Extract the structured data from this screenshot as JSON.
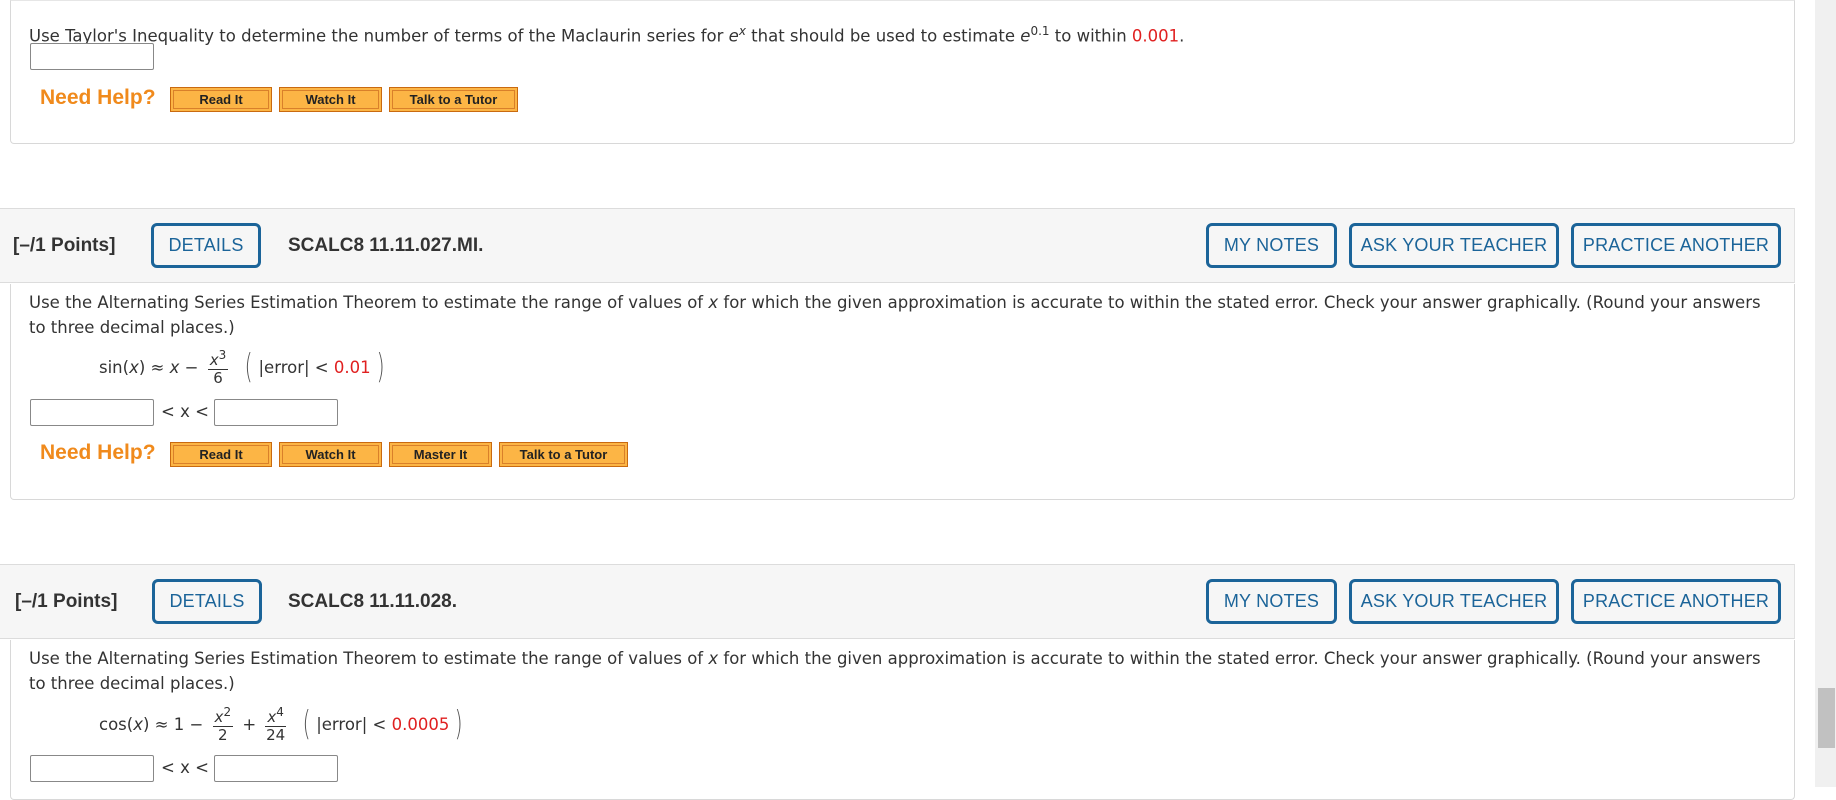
{
  "problems": [
    {
      "text_before_ex": "Use Taylor's Inequality to determine the number of terms of the Maclaurin series for ",
      "ex_base": "e",
      "ex_exp": "x",
      "text_mid": " that should be used to estimate ",
      "e_base": "e",
      "e_exp": "0.1",
      "text_after": " to within ",
      "tolerance": "0.001",
      "period": ".",
      "answer_value": "",
      "need_help": "Need Help?",
      "help_buttons": [
        "Read It",
        "Watch It",
        "Talk to a Tutor"
      ]
    },
    {
      "points": "[–/1 Points]",
      "details": "DETAILS",
      "id": "SCALC8 11.11.027.MI.",
      "actions": [
        "MY NOTES",
        "ASK YOUR TEACHER",
        "PRACTICE ANOTHER"
      ],
      "text_a": "Use the Alternating Series Estimation Theorem to estimate the range of values of ",
      "var": "x",
      "text_b": " for which the given approximation is accurate to within the stated error. Check your answer graphically. (Round your answers to three decimal places.)",
      "formula": {
        "lhs": "sin(",
        "lhs_var": "x",
        "lhs_close": ")",
        "approx": " ≈ ",
        "term1": "x",
        "minus": " − ",
        "frac_num_var": "x",
        "frac_num_exp": "3",
        "frac_den": "6",
        "error_label": "|error| < ",
        "error_value": "0.01"
      },
      "between": "< x <",
      "lower_value": "",
      "upper_value": "",
      "need_help": "Need Help?",
      "help_buttons": [
        "Read It",
        "Watch It",
        "Master It",
        "Talk to a Tutor"
      ]
    },
    {
      "points": "[–/1 Points]",
      "details": "DETAILS",
      "id": "SCALC8 11.11.028.",
      "actions": [
        "MY NOTES",
        "ASK YOUR TEACHER",
        "PRACTICE ANOTHER"
      ],
      "text_a": "Use the Alternating Series Estimation Theorem to estimate the range of values of ",
      "var": "x",
      "text_b": " for which the given approximation is accurate to within the stated error. Check your answer graphically. (Round your answers to three decimal places.)",
      "formula": {
        "lhs": "cos(",
        "lhs_var": "x",
        "lhs_close": ")",
        "approx": " ≈ 1 − ",
        "frac1_num_var": "x",
        "frac1_num_exp": "2",
        "frac1_den": "2",
        "plus": " + ",
        "frac2_num_var": "x",
        "frac2_num_exp": "4",
        "frac2_den": "24",
        "error_label": "|error| < ",
        "error_value": "0.0005"
      },
      "between": "< x <",
      "lower_value": "",
      "upper_value": ""
    }
  ]
}
